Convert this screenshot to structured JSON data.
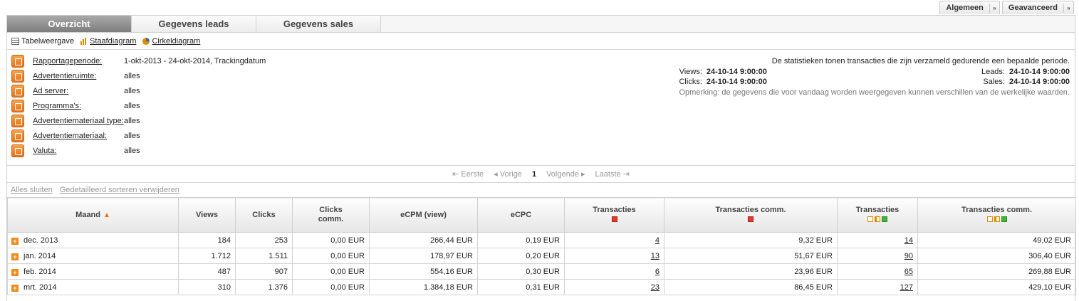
{
  "top_buttons": [
    {
      "label": "Algemeen",
      "arrow": "»"
    },
    {
      "label": "Geavanceerd",
      "arrow": "»"
    }
  ],
  "tabs": [
    {
      "label": "Overzicht",
      "active": true
    },
    {
      "label": "Gegevens leads",
      "active": false
    },
    {
      "label": "Gegevens sales",
      "active": false
    }
  ],
  "views": {
    "table": "Tabelweergave",
    "bar": "Staafdiagram",
    "pie": "Cirkeldiagram"
  },
  "filters": [
    {
      "label": "Rapportageperiode:",
      "value": "1-okt-2013 - 24-okt-2014, Trackingdatum",
      "icon": "calendar-icon"
    },
    {
      "label": "Advertentieruimte:",
      "value": "alles",
      "icon": "adspace-icon"
    },
    {
      "label": "Ad server:",
      "value": "alles",
      "icon": "adserver-icon"
    },
    {
      "label": "Programma's:",
      "value": "alles",
      "icon": "programs-icon"
    },
    {
      "label": "Advertentiemateriaal type:",
      "value": "alles",
      "icon": "admedia-type-icon"
    },
    {
      "label": "Advertentiemateriaal:",
      "value": "alles",
      "icon": "admedia-icon"
    },
    {
      "label": "Valuta:",
      "value": "alles",
      "icon": "currency-icon"
    }
  ],
  "stats": {
    "intro": "De statistieken tonen transacties die zijn verzameld gedurende een bepaalde periode.",
    "views_label": "Views:",
    "views_value": "24-10-14 9:00:00",
    "clicks_label": "Clicks:",
    "clicks_value": "24-10-14 9:00:00",
    "leads_label": "Leads:",
    "leads_value": "24-10-14 9:00:00",
    "sales_label": "Sales:",
    "sales_value": "24-10-14 9:00:00",
    "note": "Opmerking: de gegevens die voor vandaag worden weergegeven kunnen verschillen van de werkelijke waarden."
  },
  "pager": {
    "first": "Eerste",
    "prev": "Vorige",
    "current": "1",
    "next": "Volgende",
    "last": "Laatste"
  },
  "actions": {
    "close_all": "Alles sluiten",
    "remove_sort": "Gedetailleerd sorteren verwijderen"
  },
  "columns": [
    {
      "label": "Maand",
      "sub": ""
    },
    {
      "label": "Views",
      "sub": ""
    },
    {
      "label": "Clicks",
      "sub": ""
    },
    {
      "label": "Clicks",
      "sub": "comm."
    },
    {
      "label": "eCPM (view)",
      "sub": ""
    },
    {
      "label": "eCPC",
      "sub": ""
    },
    {
      "label": "Transacties",
      "sub": ""
    },
    {
      "label": "Transacties comm.",
      "sub": ""
    },
    {
      "label": "Transacties",
      "sub": ""
    },
    {
      "label": "Transacties comm.",
      "sub": ""
    }
  ],
  "rows": [
    {
      "month": "dec. 2013",
      "views": "184",
      "clicks": "253",
      "clicks_comm": "0,00 EUR",
      "ecpm": "266,44 EUR",
      "ecpc": "0,19 EUR",
      "trans_leads": "4",
      "trans_leads_comm": "9,32 EUR",
      "trans_sales": "14",
      "trans_sales_comm": "49,02 EUR"
    },
    {
      "month": "jan. 2014",
      "views": "1.712",
      "clicks": "1.511",
      "clicks_comm": "0,00 EUR",
      "ecpm": "178,97 EUR",
      "ecpc": "0,20 EUR",
      "trans_leads": "13",
      "trans_leads_comm": "51,67 EUR",
      "trans_sales": "90",
      "trans_sales_comm": "306,40 EUR"
    },
    {
      "month": "feb. 2014",
      "views": "487",
      "clicks": "907",
      "clicks_comm": "0,00 EUR",
      "ecpm": "554,16 EUR",
      "ecpc": "0,30 EUR",
      "trans_leads": "6",
      "trans_leads_comm": "23,96 EUR",
      "trans_sales": "65",
      "trans_sales_comm": "269,88 EUR"
    },
    {
      "month": "mrt. 2014",
      "views": "310",
      "clicks": "1.376",
      "clicks_comm": "0,00 EUR",
      "ecpm": "1.384,18 EUR",
      "ecpc": "0,31 EUR",
      "trans_leads": "23",
      "trans_leads_comm": "86,45 EUR",
      "trans_sales": "127",
      "trans_sales_comm": "429,10 EUR"
    }
  ]
}
